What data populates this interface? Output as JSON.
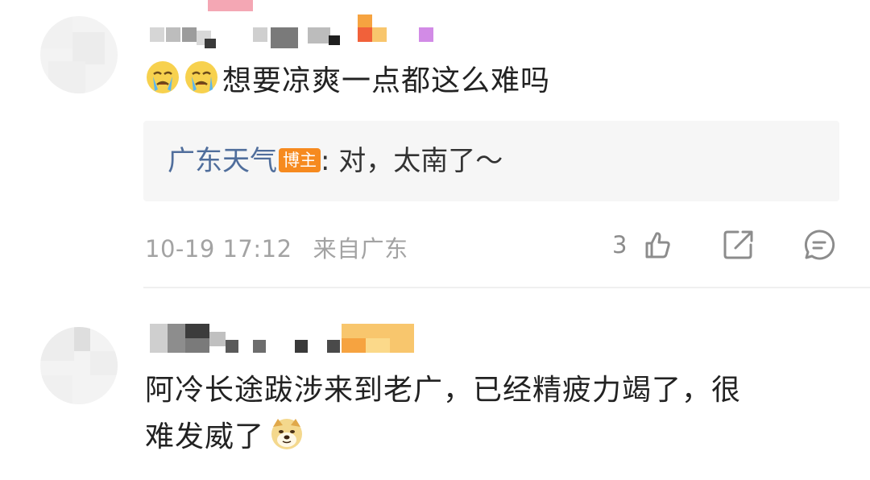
{
  "comments": [
    {
      "text": "想要凉爽一点都这么难吗",
      "emojis": [
        "crying-face-emoji",
        "crying-face-emoji"
      ],
      "reply": {
        "author": "广东天气",
        "badge": "博主",
        "separator": ":",
        "text": " 对，太南了～"
      },
      "timestamp": "10-19 17:12",
      "location": "来自广东",
      "like_count": "3"
    },
    {
      "text_line1": "阿冷长途跋涉来到老广，已经精疲力竭了，很",
      "text_line2": "难发威了",
      "emojis": [
        "doge-emoji"
      ]
    }
  ],
  "colors": {
    "reply_author": "#506e9c",
    "badge_bg": "#f68a1f",
    "meta_gray": "#a3a3a3"
  },
  "icons": {
    "like": "thumbs-up-icon",
    "repost": "share-arrow-icon",
    "comment": "comment-bubble-icon"
  }
}
